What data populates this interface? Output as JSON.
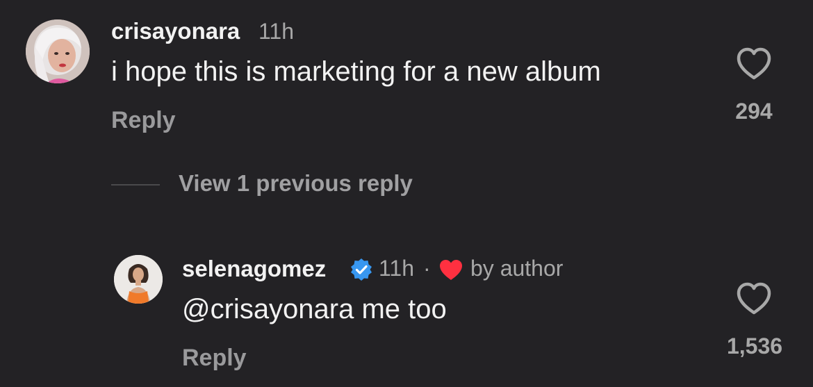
{
  "comment": {
    "username": "crisayonara",
    "time": "11h",
    "text": "i hope this is marketing for a new album",
    "reply_label": "Reply",
    "likes": "294",
    "avatar_icon": "user-avatar-photo"
  },
  "view_previous": {
    "label": "View 1 previous reply"
  },
  "reply": {
    "username": "selenagomez",
    "verified": true,
    "time": "11h",
    "separator": "·",
    "liked_by_author": "by author",
    "text": "@crisayonara me too",
    "reply_label": "Reply",
    "likes": "1,536",
    "avatar_icon": "user-avatar-photo"
  },
  "colors": {
    "background": "#232225",
    "verified_badge": "#3897f0",
    "author_heart": "#ff3040",
    "muted_text": "#a8a8a8"
  }
}
